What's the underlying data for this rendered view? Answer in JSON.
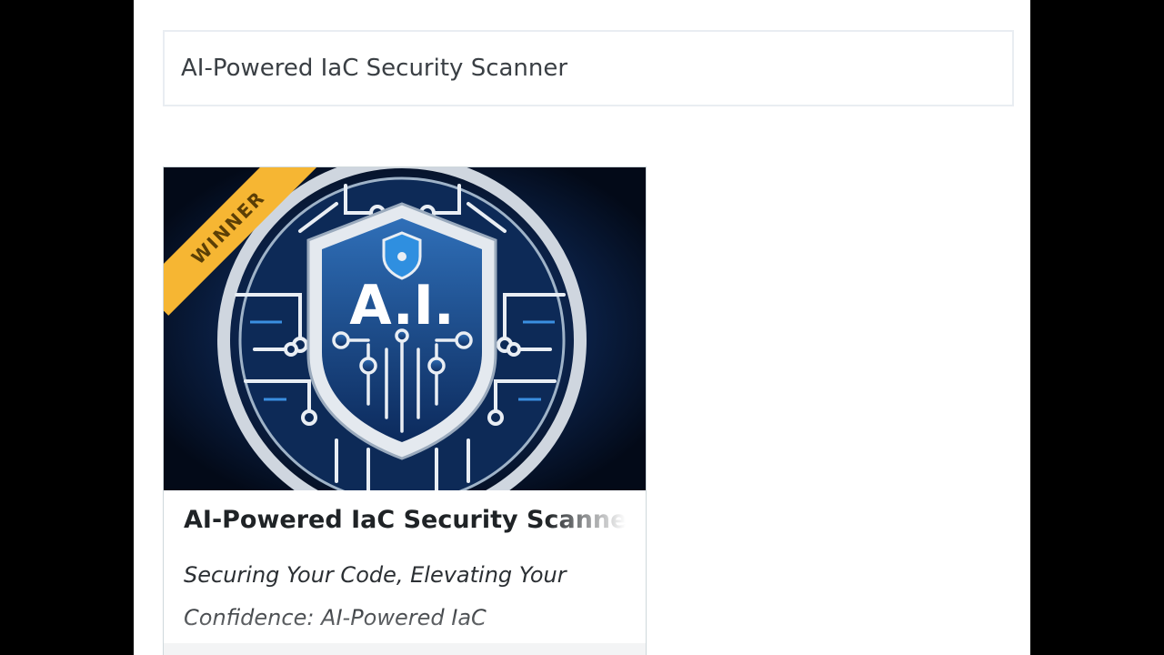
{
  "search": {
    "value": "AI-Powered IaC Security Scanner"
  },
  "card": {
    "badge": "WINNER",
    "image_text": "A.I.",
    "title": "AI-Powered IaC Security Scanner",
    "tagline": "Securing Your Code, Elevating Your Confidence: AI-Powered IaC"
  },
  "colors": {
    "ribbon": "#f6b633",
    "navy": "#06152e",
    "accent_blue": "#2f8fe0"
  }
}
